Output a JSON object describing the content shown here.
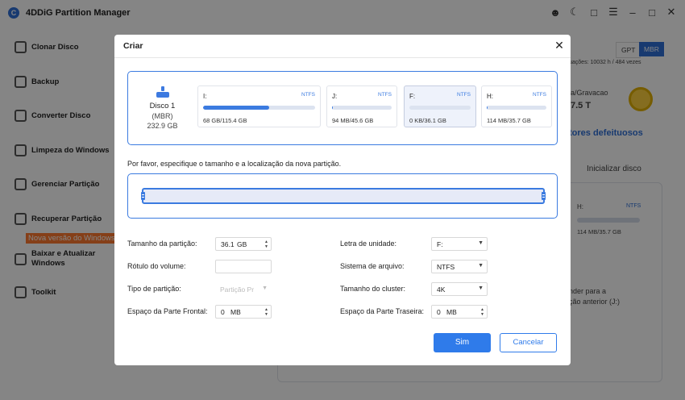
{
  "app": {
    "title": "4DDiG Partition Manager",
    "logo_letter": "C"
  },
  "sidebar": {
    "items": [
      {
        "label": "Clonar Disco"
      },
      {
        "label": "Backup"
      },
      {
        "label": "Converter Disco"
      },
      {
        "label": "Limpeza do Windows"
      },
      {
        "label": "Gerenciar Partição"
      },
      {
        "label": "Recuperar Partição"
      },
      {
        "label": "Baixar e Atualizar Windows"
      },
      {
        "label": "Toolkit"
      }
    ],
    "banner": "Nova versão do Windows"
  },
  "background": {
    "gpt": "GPT",
    "mbr": "MBR",
    "sectors": "uações: 10032 h / 484 vezes",
    "temp": "a/Gravacao",
    "temp_value": "7.5 T",
    "bad_sectors": "tores defeituosos",
    "init_disk": "Inicializar disco",
    "h_label": "H:",
    "h_fs": "NTFS",
    "h_usage": "114 MB/35.7 GB",
    "restore_1": "nder para a",
    "restore_2": "ção anterior (J:)"
  },
  "dialog": {
    "title": "Criar",
    "disk": {
      "name": "Disco 1",
      "type": "(MBR)",
      "size": "232.9 GB"
    },
    "partitions": [
      {
        "letter": "I:",
        "fs": "NTFS",
        "usage": "68 GB/115.4 GB",
        "used_fraction": 0.59
      },
      {
        "letter": "J:",
        "fs": "NTFS",
        "usage": "94 MB/45.6 GB",
        "used_fraction": 0.01
      },
      {
        "letter": "F:",
        "fs": "NTFS",
        "usage": "0 KB/36.1 GB",
        "used_fraction": 0.0
      },
      {
        "letter": "H:",
        "fs": "NTFS",
        "usage": "114 MB/35.7 GB",
        "used_fraction": 0.01
      }
    ],
    "instruction": "Por favor, especifique o tamanho e a localização da nova partição.",
    "fields": {
      "size_label": "Tamanho da partição:",
      "size_value": "36.1",
      "size_unit": "GB",
      "volume_label": "Rótulo do volume:",
      "volume_value": "",
      "type_label": "Tipo de partição:",
      "type_value": "Partição Pr",
      "front_label": "Espaço da Parte Frontal:",
      "front_value": "0",
      "front_unit": "MB",
      "drive_letter_label": "Letra de unidade:",
      "drive_letter_value": "F:",
      "fs_label": "Sistema de arquivo:",
      "fs_value": "NTFS",
      "cluster_label": "Tamanho do cluster:",
      "cluster_value": "4K",
      "rear_label": "Espaço da Parte Traseira:",
      "rear_value": "0",
      "rear_unit": "MB"
    },
    "ok": "Sim",
    "cancel": "Cancelar"
  }
}
